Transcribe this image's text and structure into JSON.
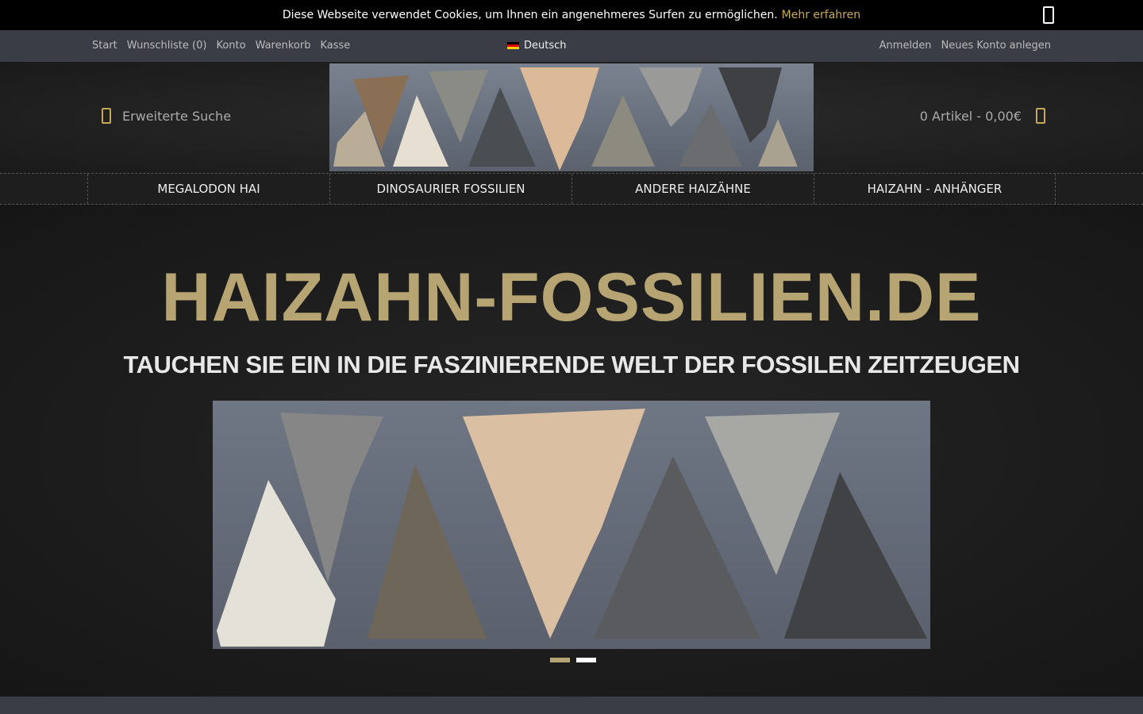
{
  "cookie": {
    "text": "Diese Webseite verwendet Cookies, um Ihnen ein angenehmeres Surfen zu ermöglichen.",
    "more_label": "Mehr erfahren",
    "close_icon": "close-icon"
  },
  "topbar": {
    "links": [
      "Start",
      "Wunschliste (0)",
      "Konto",
      "Warenkorb",
      "Kasse"
    ],
    "language": "Deutsch",
    "account_links": [
      "Anmelden",
      "Neues Konto anlegen"
    ]
  },
  "header": {
    "search_label": "Erweiterte Suche",
    "cart_label": "0 Artikel - 0,00€"
  },
  "nav": {
    "items": [
      "MEGALODON HAI",
      "DINOSAURIER FOSSILIEN",
      "ANDERE HAIZÄHNE",
      "HAIZAHN - ANHÄNGER"
    ]
  },
  "hero": {
    "title": "HAIZAHN-FOSSILIEN.DE",
    "subtitle": "TAUCHEN SIE EIN IN DIE FASZINIERENDE WELT DER FOSSILEN ZEITZEUGEN",
    "slides": 2,
    "active_slide": 1
  },
  "colors": {
    "accent": "#c7a85a",
    "topbar": "#3a3d45"
  }
}
